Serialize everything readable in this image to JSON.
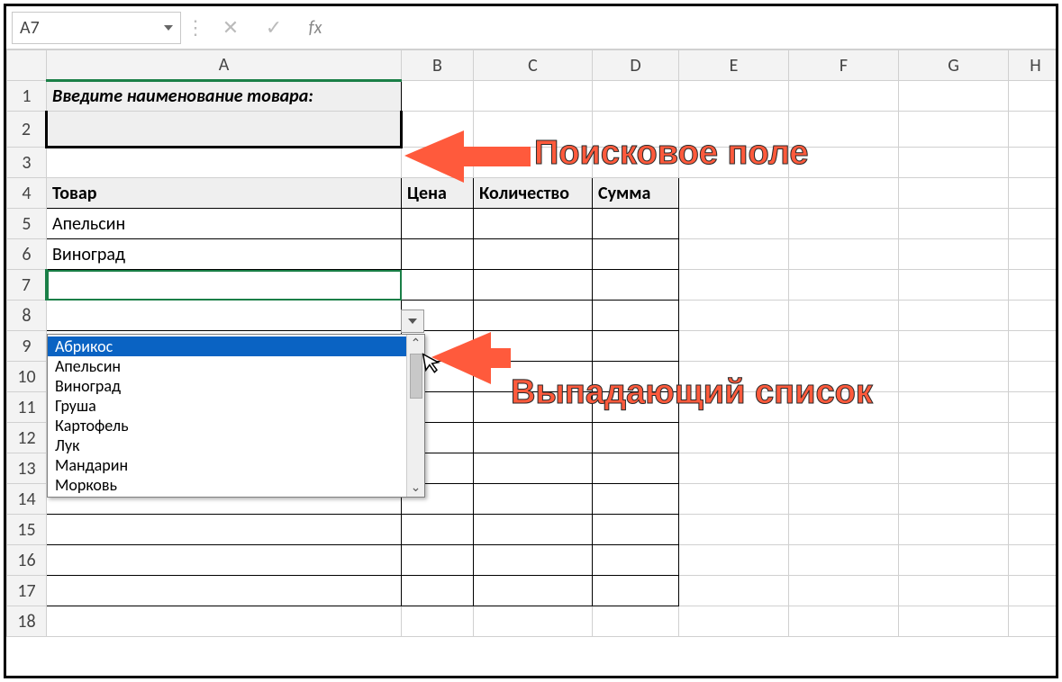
{
  "formula_bar": {
    "cell_ref": "A7",
    "cancel_glyph": "✕",
    "enter_glyph": "✓",
    "fx_label": "fx",
    "formula_value": ""
  },
  "columns": [
    "A",
    "B",
    "C",
    "D",
    "E",
    "F",
    "G",
    "H"
  ],
  "rows": [
    "1",
    "2",
    "3",
    "4",
    "5",
    "6",
    "7",
    "8",
    "9",
    "10",
    "11",
    "12",
    "13",
    "14",
    "15",
    "16",
    "17",
    "18"
  ],
  "sheet": {
    "prompt": "Введите наименование товара:",
    "search_value": "",
    "headers": {
      "product": "Товар",
      "price": "Цена",
      "qty": "Количество",
      "sum": "Сумма"
    },
    "data_rows": [
      "Апельсин",
      "Виноград"
    ]
  },
  "dropdown": {
    "items": [
      "Абрикос",
      "Апельсин",
      "Виноград",
      "Груша",
      "Картофель",
      "Лук",
      "Мандарин",
      "Морковь"
    ],
    "selected_index": 0,
    "scroll_up": "⌃",
    "scroll_down": "⌄"
  },
  "annotations": {
    "search": "Поисковое поле",
    "dropdown": "Выпадающий список"
  }
}
